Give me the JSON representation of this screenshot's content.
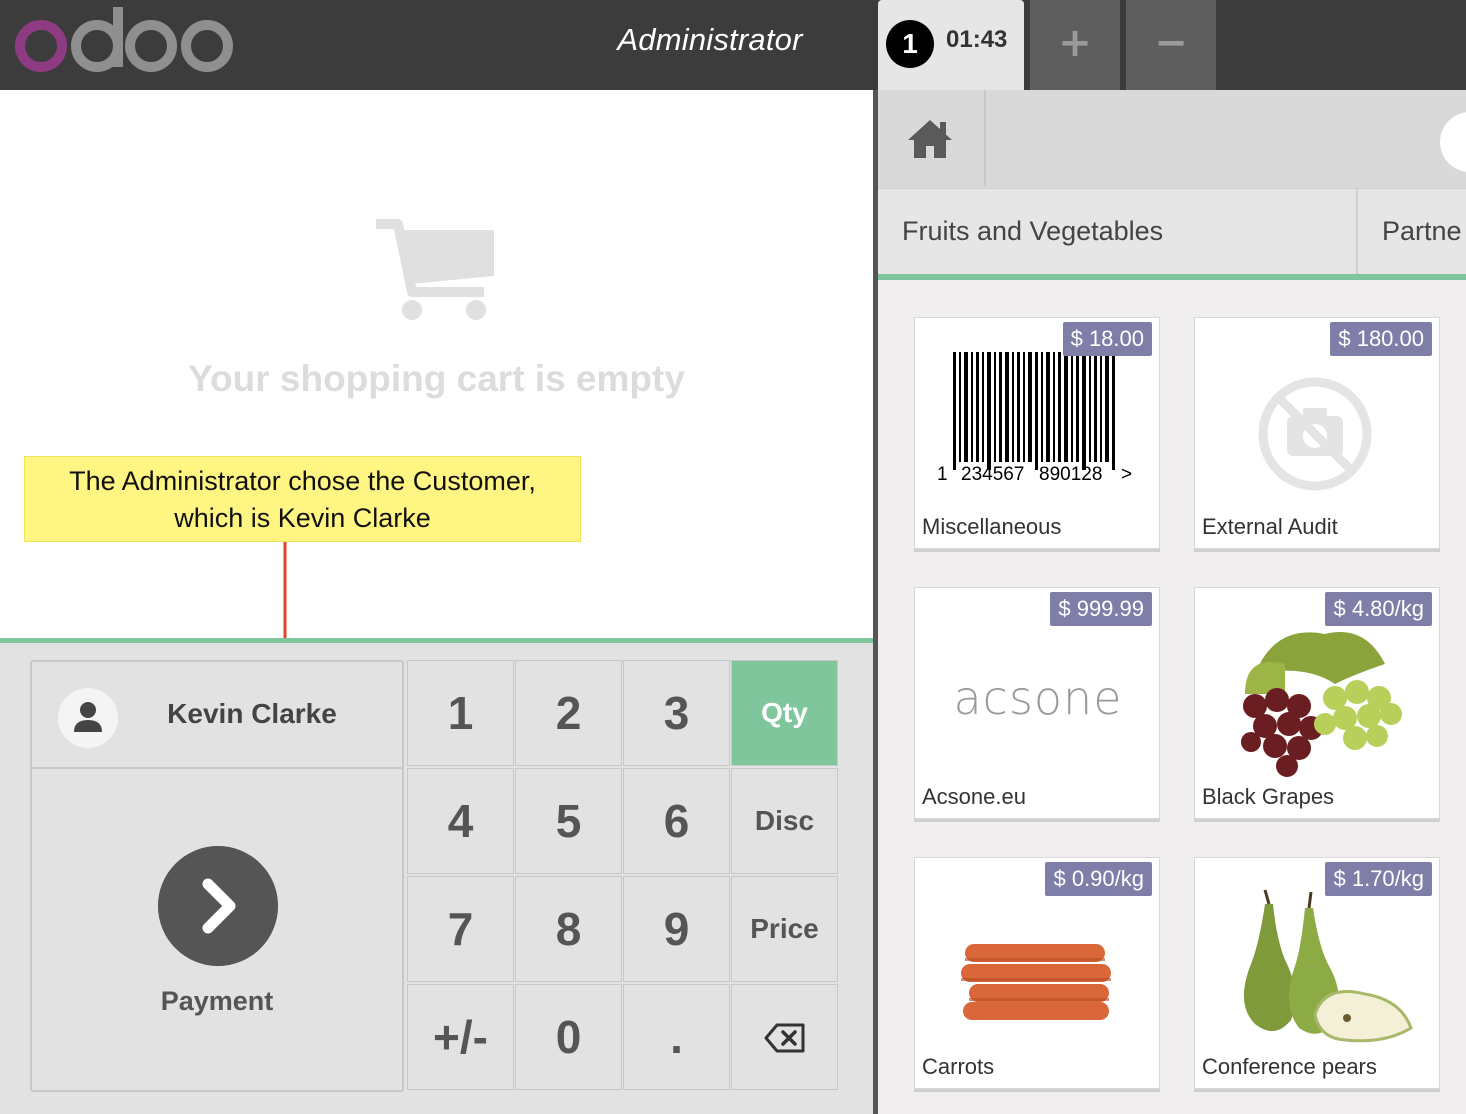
{
  "header": {
    "logo_text": "odoo",
    "cashier_name": "Administrator",
    "order_tab": {
      "number": "1",
      "time": "01:43"
    },
    "add_order_label": "+",
    "remove_order_label": "−"
  },
  "cart": {
    "empty_message": "Your shopping cart is empty"
  },
  "annotation": {
    "line1": "The Administrator chose the Customer,",
    "line2": "which is Kevin Clarke"
  },
  "actions": {
    "customer_name": "Kevin Clarke",
    "payment_label": "Payment"
  },
  "numpad": {
    "keys": [
      "1",
      "2",
      "3",
      "4",
      "5",
      "6",
      "7",
      "8",
      "9",
      "+/-",
      "0",
      "."
    ],
    "modes": [
      "Qty",
      "Disc",
      "Price"
    ],
    "active_mode": "Qty"
  },
  "categories": {
    "current": "Fruits and Vegetables",
    "next": "Partne"
  },
  "products": [
    {
      "name": "Miscellaneous",
      "price": "$ 18.00",
      "icon": "barcode-image"
    },
    {
      "name": "External Audit",
      "price": "$ 180.00",
      "icon": "no-image-icon"
    },
    {
      "name": "Acsone.eu",
      "price": "$ 999.99",
      "icon": "acsone-logo",
      "logo_text": "acsone"
    },
    {
      "name": "Black Grapes",
      "price": "$ 4.80/kg",
      "icon": "grapes-image"
    },
    {
      "name": "Carrots",
      "price": "$ 0.90/kg",
      "icon": "carrots-image"
    },
    {
      "name": "Conference pears",
      "price": "$ 1.70/kg",
      "icon": "pears-image"
    }
  ],
  "colors": {
    "topbar": "#3c3c3c",
    "accent_green": "#7fc69d",
    "price_tag": "#7e7ea9",
    "logo_purple": "#8f3b84",
    "logo_grey": "#8f8f8f"
  }
}
